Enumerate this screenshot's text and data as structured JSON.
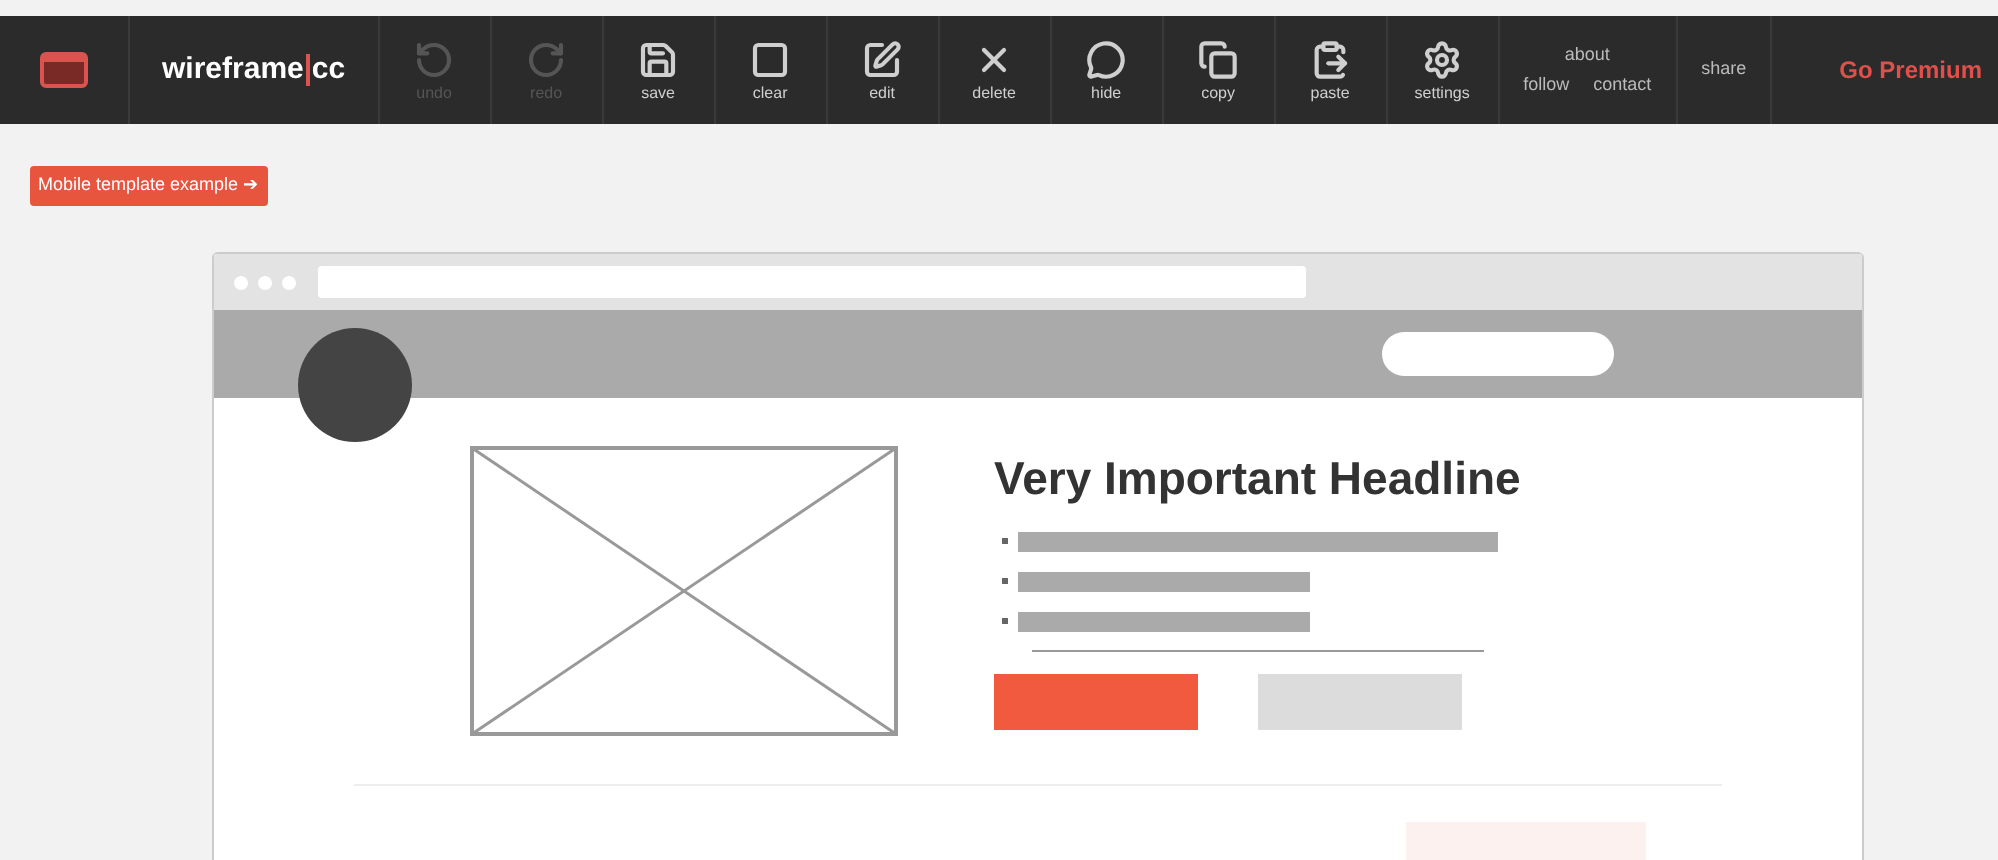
{
  "toolbar": {
    "logo": "wireframe",
    "logo_suffix": "cc",
    "tools": [
      {
        "label": "undo",
        "disabled": true
      },
      {
        "label": "redo",
        "disabled": true
      },
      {
        "label": "save",
        "disabled": false
      },
      {
        "label": "clear",
        "disabled": false
      },
      {
        "label": "edit",
        "disabled": false
      },
      {
        "label": "delete",
        "disabled": false
      },
      {
        "label": "hide",
        "disabled": false
      },
      {
        "label": "copy",
        "disabled": false
      },
      {
        "label": "paste",
        "disabled": false
      },
      {
        "label": "settings",
        "disabled": false
      }
    ],
    "links": {
      "about": "about",
      "follow": "follow",
      "contact": "contact"
    },
    "share": "share",
    "premium": "Go Premium"
  },
  "template_button": "Mobile template example ➔",
  "canvas": {
    "headline": "Very Important Headline"
  }
}
